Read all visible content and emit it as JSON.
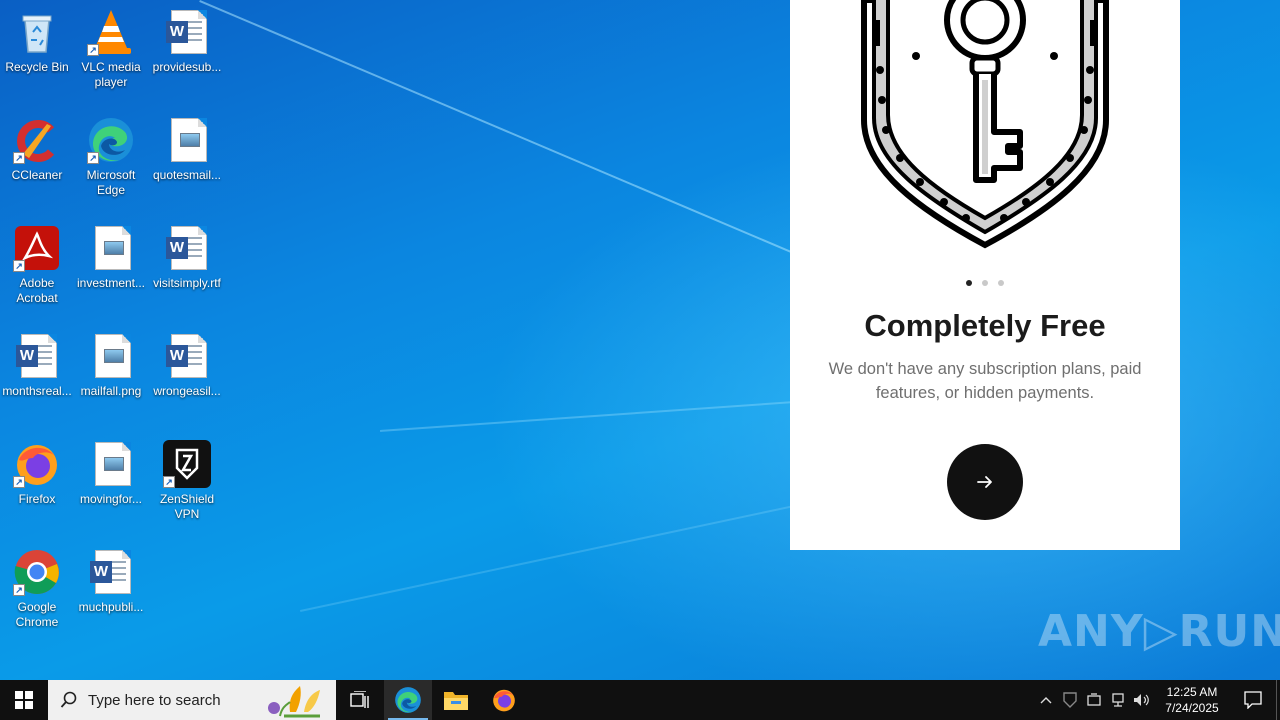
{
  "desktop": {
    "icons": [
      {
        "label": "Recycle Bin",
        "icon": "recycle-bin-icon"
      },
      {
        "label": "VLC media player",
        "icon": "vlc-icon"
      },
      {
        "label": "providesub...",
        "icon": "word-doc-icon"
      },
      {
        "label": "CCleaner",
        "icon": "ccleaner-icon"
      },
      {
        "label": "Microsoft Edge",
        "icon": "edge-icon"
      },
      {
        "label": "quotesmail...",
        "icon": "image-file-icon"
      },
      {
        "label": "Adobe Acrobat",
        "icon": "acrobat-icon"
      },
      {
        "label": "investment...",
        "icon": "image-file-icon"
      },
      {
        "label": "visitsimply.rtf",
        "icon": "word-doc-icon"
      },
      {
        "label": "monthsreal...",
        "icon": "word-doc-icon"
      },
      {
        "label": "mailfall.png",
        "icon": "image-file-icon"
      },
      {
        "label": "wrongeasil...",
        "icon": "word-doc-icon"
      },
      {
        "label": "Firefox",
        "icon": "firefox-icon"
      },
      {
        "label": "movingfor...",
        "icon": "image-file-icon"
      },
      {
        "label": "ZenShield VPN",
        "icon": "zenshield-icon"
      },
      {
        "label": "Google Chrome",
        "icon": "chrome-icon"
      },
      {
        "label": "muchpubli...",
        "icon": "word-doc-icon"
      }
    ]
  },
  "onboarding": {
    "illustration": "shield-key-icon",
    "page_dots": 3,
    "active_dot": 1,
    "title": "Completely Free",
    "description": "We don't have any subscription plans, paid features, or hidden payments.",
    "next_icon": "arrow-right-icon"
  },
  "watermark": {
    "text_left": "ANY",
    "text_right": "RUN"
  },
  "taskbar": {
    "search_placeholder": "Type here to search",
    "pinned": [
      "task-view-icon",
      "edge-icon",
      "file-explorer-icon",
      "firefox-icon"
    ],
    "clock_time": "12:25 AM",
    "clock_date": "7/24/2025"
  },
  "colors": {
    "accent": "#0a7fd8",
    "taskbar": "#101010",
    "button": "#111111"
  }
}
